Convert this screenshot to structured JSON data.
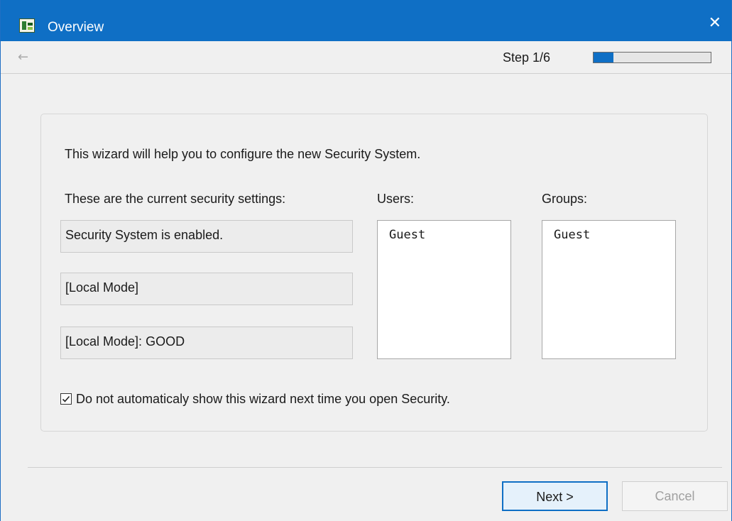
{
  "window": {
    "title": "Overview",
    "close_symbol": "✕",
    "accent_color": "#0f6fc5",
    "icon": "app-icon"
  },
  "toolbar": {
    "back_symbol": "←",
    "step_text": "Step 1/6",
    "progress_fraction": 0.1667
  },
  "main": {
    "intro_text": "This wizard will help you to configure the new Security System.",
    "current_settings_label": "These are the current security settings:",
    "settings": [
      "Security System is enabled.",
      "[Local Mode]",
      "[Local Mode]: GOOD"
    ],
    "users_label": "Users:",
    "users": [
      "Guest"
    ],
    "groups_label": "Groups:",
    "groups": [
      "Guest"
    ],
    "checkbox_label": "Do not automaticaly show this wizard next time you open Security.",
    "checkbox_checked": true
  },
  "buttons": {
    "next_label": "Next >",
    "cancel_label": "Cancel"
  }
}
